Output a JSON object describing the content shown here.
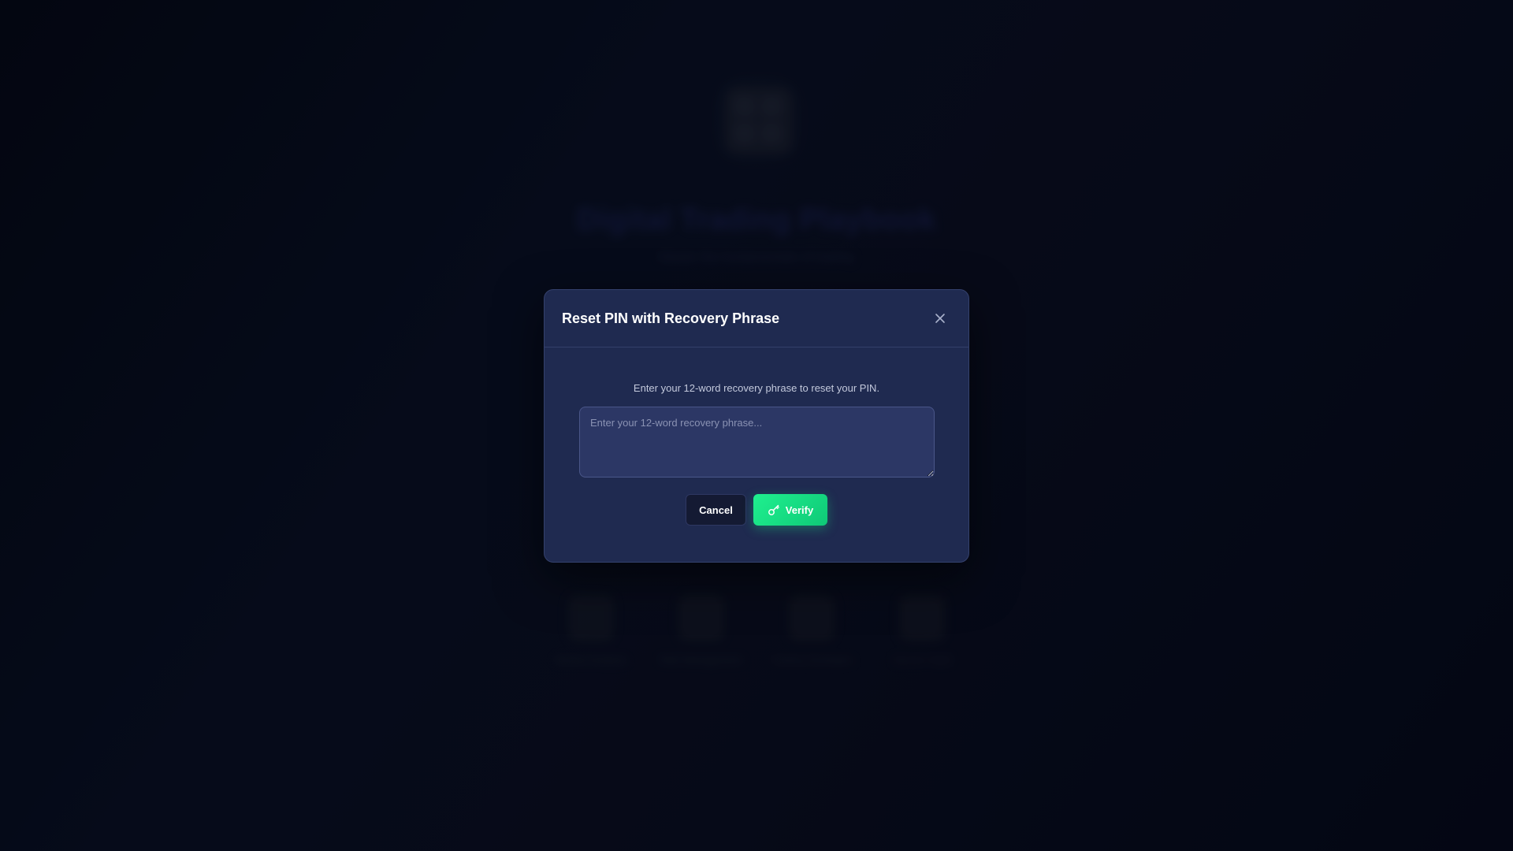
{
  "background": {
    "title": "Digital Trading Playbook",
    "subtitle": "Master the fundamentals of trading",
    "features": [
      {
        "icon": "chart-icon",
        "label": "Market Analysis"
      },
      {
        "icon": "shield-icon",
        "label": "Risk Management"
      },
      {
        "icon": "trend-icon",
        "label": "Trading Strategies"
      },
      {
        "icon": "lock-icon",
        "label": "Secure Vault"
      }
    ]
  },
  "modal": {
    "title": "Reset PIN with Recovery Phrase",
    "close_icon": "close-icon",
    "instruction": "Enter your 12-word recovery phrase to reset your PIN.",
    "phrase_input": {
      "value": "",
      "placeholder": "Enter your 12-word recovery phrase..."
    },
    "cancel_label": "Cancel",
    "verify_label": "Verify",
    "verify_icon": "key-icon"
  },
  "colors": {
    "accent": "#1ff08f",
    "modal_bg": "#1f2a50",
    "page_bg": "#070b1a"
  }
}
